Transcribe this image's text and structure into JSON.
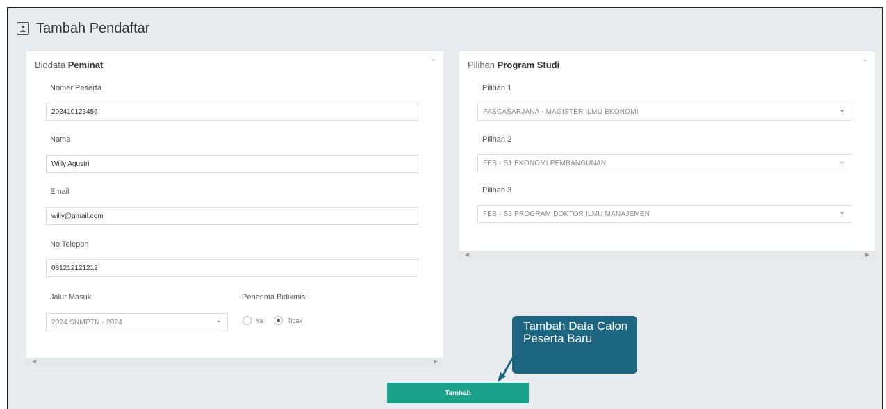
{
  "page": {
    "title": "Tambah Pendaftar",
    "header_icon": "user-card-icon"
  },
  "biodata": {
    "title_light": "Biodata",
    "title_bold": "Peminat",
    "fields": {
      "nomer_peserta": {
        "label": "Nomer Peserta",
        "value": "202410123456"
      },
      "nama": {
        "label": "Nama",
        "value": "Willy Agustri"
      },
      "email": {
        "label": "Email",
        "value": "willy@gmail.com"
      },
      "telepon": {
        "label": "No Telepon",
        "value": "081212121212"
      },
      "jalur": {
        "label": "Jalur Masuk",
        "value": "2024 SNMPTN - 2024"
      },
      "bidikmisi": {
        "label": "Penerima Bidikmisi",
        "options": [
          "Ya",
          "Tidak"
        ],
        "selected": "Tidak"
      }
    }
  },
  "prodi": {
    "title_light": "Pilihan",
    "title_bold": "Program Studi",
    "choices": [
      {
        "label": "Pilihan 1",
        "value": "PASCASARJANA - MAGISTER ILMU EKONOMI"
      },
      {
        "label": "Pilihan 2",
        "value": "FEB - S1 EKONOMI PEMBANGUNAN"
      },
      {
        "label": "Pilihan 3",
        "value": "FEB - S3 PROGRAM DOKTOR ILMU MANAJEMEN"
      }
    ]
  },
  "submit_label": "Tambah",
  "callout": {
    "text": "Tambah Data Calon Peserta Baru"
  },
  "colors": {
    "submit": "#1aa38a",
    "callout": "#1c6682",
    "background": "#e9ecef"
  }
}
